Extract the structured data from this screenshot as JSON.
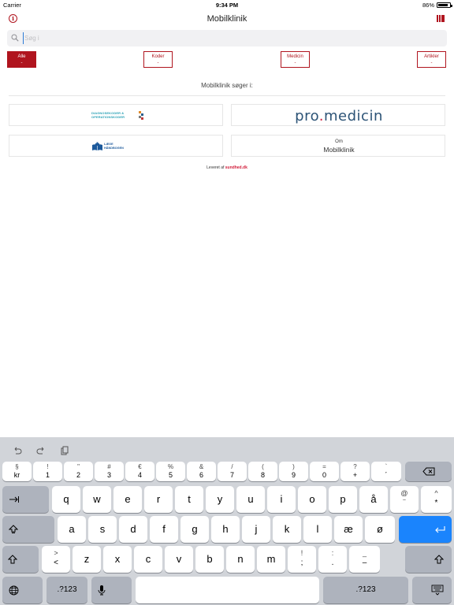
{
  "status_bar": {
    "carrier": "Carrier",
    "time": "9:34 PM",
    "battery": "86%"
  },
  "nav": {
    "title": "Mobilklinik",
    "info_icon": "info-icon",
    "bookmark_icon": "bookmark-icon",
    "brand_color": "#b0141e"
  },
  "search": {
    "placeholder": "Søg i",
    "icon": "search-icon"
  },
  "filters": [
    {
      "label": "Alle",
      "count": "-",
      "active": true
    },
    {
      "label": "Koder",
      "count": "-",
      "active": false
    },
    {
      "label": "Medicin",
      "count": "-",
      "active": false
    },
    {
      "label": "Artikler",
      "count": "-",
      "active": false
    }
  ],
  "search_heading": "Mobilklinik søger i:",
  "sources": {
    "diagnose_line1": "DIAGNOSEKODER &",
    "diagnose_line2": "OPERATIONSKODER",
    "promedicin_prefix": "pro",
    "promedicin_dot": ".",
    "promedicin_suffix": "medicin",
    "laege_line1": "LÆGE",
    "laege_line2": "HÅNDBOGEN",
    "om_label": "Om",
    "om_sub": "Mobilklinik"
  },
  "powered_by": {
    "prefix": "Leveret af",
    "brand": "sundhed",
    "suffix": ".dk"
  },
  "keyboard": {
    "toolbar_icons": [
      "undo-icon",
      "redo-icon",
      "paste-icon"
    ],
    "number_row": [
      {
        "top": "§",
        "bot": "kr"
      },
      {
        "top": "!",
        "bot": "1"
      },
      {
        "top": "\"",
        "bot": "2"
      },
      {
        "top": "#",
        "bot": "3"
      },
      {
        "top": "€",
        "bot": "4"
      },
      {
        "top": "%",
        "bot": "5"
      },
      {
        "top": "&",
        "bot": "6"
      },
      {
        "top": "/",
        "bot": "7"
      },
      {
        "top": "(",
        "bot": "8"
      },
      {
        "top": ")",
        "bot": "9"
      },
      {
        "top": "=",
        "bot": "0"
      },
      {
        "top": "?",
        "bot": "+"
      },
      {
        "top": "`",
        "bot": "´"
      }
    ],
    "row1": [
      "q",
      "w",
      "e",
      "r",
      "t",
      "y",
      "u",
      "i",
      "o",
      "p",
      "å"
    ],
    "row1_extra": [
      {
        "top": "@",
        "bot": "¨"
      },
      {
        "top": "^",
        "bot": "*"
      }
    ],
    "row2": [
      "a",
      "s",
      "d",
      "f",
      "g",
      "h",
      "j",
      "k",
      "l",
      "æ",
      "ø"
    ],
    "row3_first": {
      "top": ">",
      "bot": "<"
    },
    "row3": [
      "z",
      "x",
      "c",
      "v",
      "b",
      "n",
      "m"
    ],
    "row3_punct": [
      {
        "top": "!",
        "bot": ";"
      },
      {
        "top": ":",
        "bot": "."
      },
      {
        "top": "_",
        "bot": "–"
      }
    ],
    "numbers_label": ".?123",
    "return_color": "#1a84fd"
  }
}
